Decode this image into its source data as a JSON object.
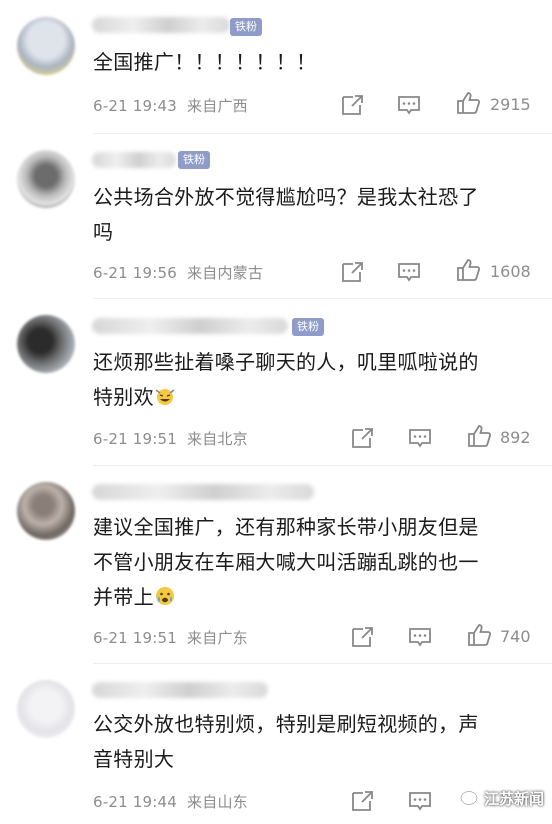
{
  "badge_label": "铁粉",
  "comments": [
    {
      "text": "全国推广！！！！！！！",
      "date": "6-21 19:43",
      "location": "来自广西",
      "likes": "2915"
    },
    {
      "text_lines": [
        "公共场合外放不觉得尴尬吗？是我太社恐了",
        "吗"
      ],
      "date": "6-21 19:56",
      "location": "来自内蒙古",
      "likes": "1608"
    },
    {
      "text_lines": [
        "还烦那些扯着嗓子聊天的人，叽里呱啦说的",
        "特别欢"
      ],
      "date": "6-21 19:51",
      "location": "来自北京",
      "likes": "892"
    },
    {
      "text_lines": [
        "建议全国推广，还有那种家长带小朋友但是",
        "不管小朋友在车厢大喊大叫活蹦乱跳的也一",
        "并带上"
      ],
      "date": "6-21 19:51",
      "location": "来自广东",
      "likes": "740"
    },
    {
      "text_lines": [
        "公交外放也特别烦，特别是刷短视频的，声",
        "音特别大"
      ],
      "date": "6-21 19:44",
      "location": "来自山东",
      "likes": ""
    }
  ],
  "watermark": "江苏新闻"
}
